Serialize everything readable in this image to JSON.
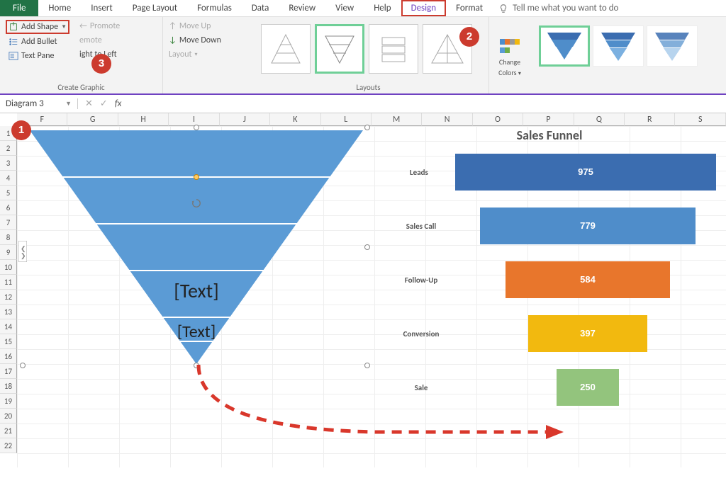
{
  "tabs": {
    "file": "File",
    "home": "Home",
    "insert": "Insert",
    "pagelayout": "Page Layout",
    "formulas": "Formulas",
    "data": "Data",
    "review": "Review",
    "view": "View",
    "help": "Help",
    "design": "Design",
    "format": "Format",
    "tellme": "Tell me what you want to do"
  },
  "ribbon": {
    "create_graphic": {
      "add_shape": "Add Shape",
      "add_bullet": "Add Bullet",
      "text_pane": "Text Pane",
      "promote": "Promote",
      "demote": "emote",
      "right_to_left": "ight to Left",
      "move_up": "Move Up",
      "move_down": "Move Down",
      "layout": "Layout",
      "group_label": "Create Graphic"
    },
    "layouts": {
      "group_label": "Layouts"
    },
    "change_colors": {
      "line1": "Change",
      "line2": "Colors"
    }
  },
  "callouts": {
    "c1": "1",
    "c2": "2",
    "c3": "3"
  },
  "namebox": "Diagram 3",
  "fx": "fx",
  "columns": [
    "F",
    "G",
    "H",
    "I",
    "J",
    "K",
    "L",
    "M",
    "N",
    "O",
    "P",
    "Q",
    "R",
    "S"
  ],
  "rows": [
    "1",
    "2",
    "3",
    "4",
    "5",
    "6",
    "7",
    "8",
    "9",
    "10",
    "11",
    "12",
    "13",
    "14",
    "15",
    "16",
    "17",
    "18",
    "19",
    "20",
    "21",
    "22"
  ],
  "smartart": {
    "t1": "[Text]",
    "t2": "[Text]"
  },
  "chart_data": {
    "type": "bar",
    "title": "Sales Funnel",
    "categories": [
      "Leads",
      "Sales Call",
      "Follow-Up",
      "Conversion",
      "Sale"
    ],
    "values": [
      975,
      779,
      584,
      397,
      250
    ],
    "colors": [
      "#3b6db0",
      "#4f8dca",
      "#e8762c",
      "#f2b90f",
      "#93c47d"
    ],
    "widths": [
      368,
      304,
      232,
      168,
      88
    ]
  }
}
